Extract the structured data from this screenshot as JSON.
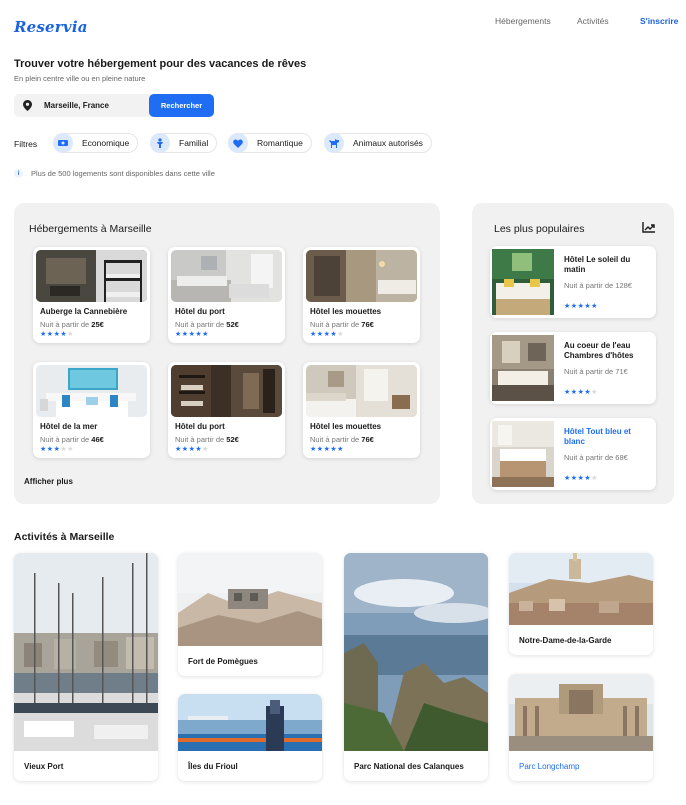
{
  "header": {
    "logo": "Reservia",
    "nav": [
      "Hébergements",
      "Activités",
      "S'inscrire"
    ]
  },
  "hero": {
    "title": "Trouver votre hébergement pour des vacances de rêves",
    "subtitle": "En plein centre ville ou en pleine nature"
  },
  "search": {
    "value": "Marseille, France",
    "button": "Rechercher",
    "icon": "map-pin-icon"
  },
  "filters": {
    "label": "Filtres",
    "items": [
      {
        "label": "Economique",
        "icon": "money-icon"
      },
      {
        "label": "Familial",
        "icon": "child-icon"
      },
      {
        "label": "Romantique",
        "icon": "heart-icon"
      },
      {
        "label": "Animaux autorisés",
        "icon": "dog-icon"
      }
    ]
  },
  "info_text": "Plus de 500 logements sont disponibles dans cette ville",
  "lodging": {
    "title": "Hébergements à Marseille",
    "show_more": "Afficher plus",
    "cards": [
      {
        "name": "Auberge la Cannebière",
        "price_prefix": "Nuit à partir de ",
        "price": "25€",
        "stars": 4
      },
      {
        "name": "Hôtel du port",
        "price_prefix": "Nuit à partir de ",
        "price": "52€",
        "stars": 5
      },
      {
        "name": "Hôtel les mouettes",
        "price_prefix": "Nuit à partir de ",
        "price": "76€",
        "stars": 4
      },
      {
        "name": "Hôtel de la mer",
        "price_prefix": "Nuit à partir de ",
        "price": "46€",
        "stars": 3
      },
      {
        "name": "Hôtel du port",
        "price_prefix": "Nuit à partir de ",
        "price": "52€",
        "stars": 4
      },
      {
        "name": "Hôtel les mouettes",
        "price_prefix": "Nuit à partir de ",
        "price": "76€",
        "stars": 5
      }
    ]
  },
  "popular": {
    "title": "Les plus populaires",
    "icon": "trending-up-icon",
    "cards": [
      {
        "name": "Hôtel Le soleil du matin",
        "price": "Nuit à partir de 128€",
        "stars": 5
      },
      {
        "name": "Au coeur de l'eau Chambres d'hôtes",
        "price": "Nuit à partir de 71€",
        "stars": 4
      },
      {
        "name": "Hôtel Tout bleu et blanc",
        "price": "Nuit à partir de 68€",
        "stars": 4
      }
    ]
  },
  "activities": {
    "title": "Activités à Marseille",
    "items": [
      {
        "label": "Vieux Port"
      },
      {
        "label": "Fort de Pomègues"
      },
      {
        "label": "Îles du Frioul"
      },
      {
        "label": "Parc National des Calanques"
      },
      {
        "label": "Notre-Dame-de-la-Garde"
      },
      {
        "label": "Parc Longchamp"
      }
    ]
  },
  "colors": {
    "accent": "#1e6df2",
    "panel_bg": "#f1f1f1",
    "star_off": "#d8d8d8"
  }
}
